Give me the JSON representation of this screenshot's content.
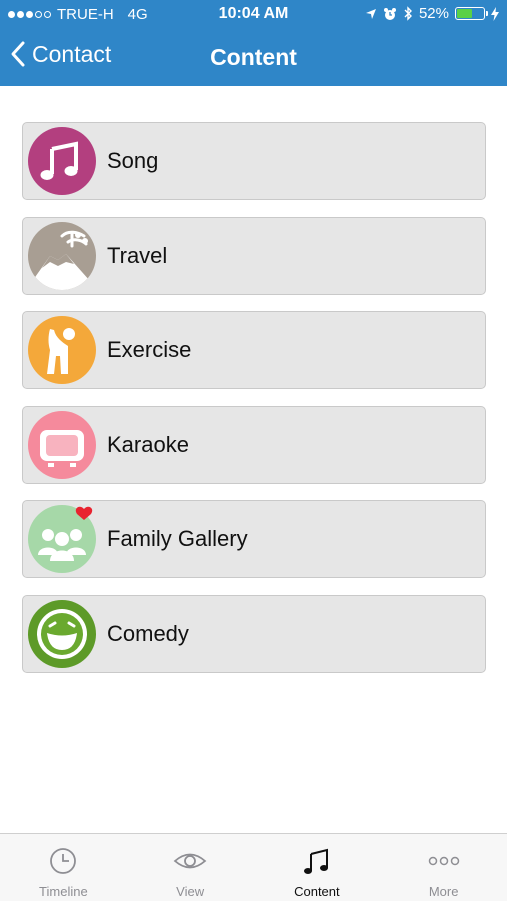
{
  "status_bar": {
    "carrier": "TRUE-H",
    "network": "4G",
    "time": "10:04 AM",
    "battery_percent": "52%",
    "battery_level": 0.52
  },
  "nav": {
    "back_label": "Contact",
    "title": "Content"
  },
  "content_items": [
    {
      "label": "Song",
      "icon": "music-note-icon",
      "color": "#b33f7f"
    },
    {
      "label": "Travel",
      "icon": "mount-fuji-icon",
      "color": "#a89e93"
    },
    {
      "label": "Exercise",
      "icon": "stretching-person-icon",
      "color": "#f4a83a"
    },
    {
      "label": "Karaoke",
      "icon": "tv-screen-icon",
      "color": "#f58a9c"
    },
    {
      "label": "Family Gallery",
      "icon": "family-heart-icon",
      "color": "#a6d8a8"
    },
    {
      "label": "Comedy",
      "icon": "laughing-face-icon",
      "color": "#5d9a28"
    }
  ],
  "tab_bar": {
    "tabs": [
      {
        "label": "Timeline",
        "icon": "clock-icon",
        "active": false
      },
      {
        "label": "View",
        "icon": "eye-icon",
        "active": false
      },
      {
        "label": "Content",
        "icon": "music-notes-icon",
        "active": true
      },
      {
        "label": "More",
        "icon": "more-dots-icon",
        "active": false
      }
    ]
  },
  "colors": {
    "header": "#2f86c8",
    "list_item_bg": "#e6e6e6",
    "tab_active": "#111111",
    "tab_inactive": "#8e8e93"
  }
}
